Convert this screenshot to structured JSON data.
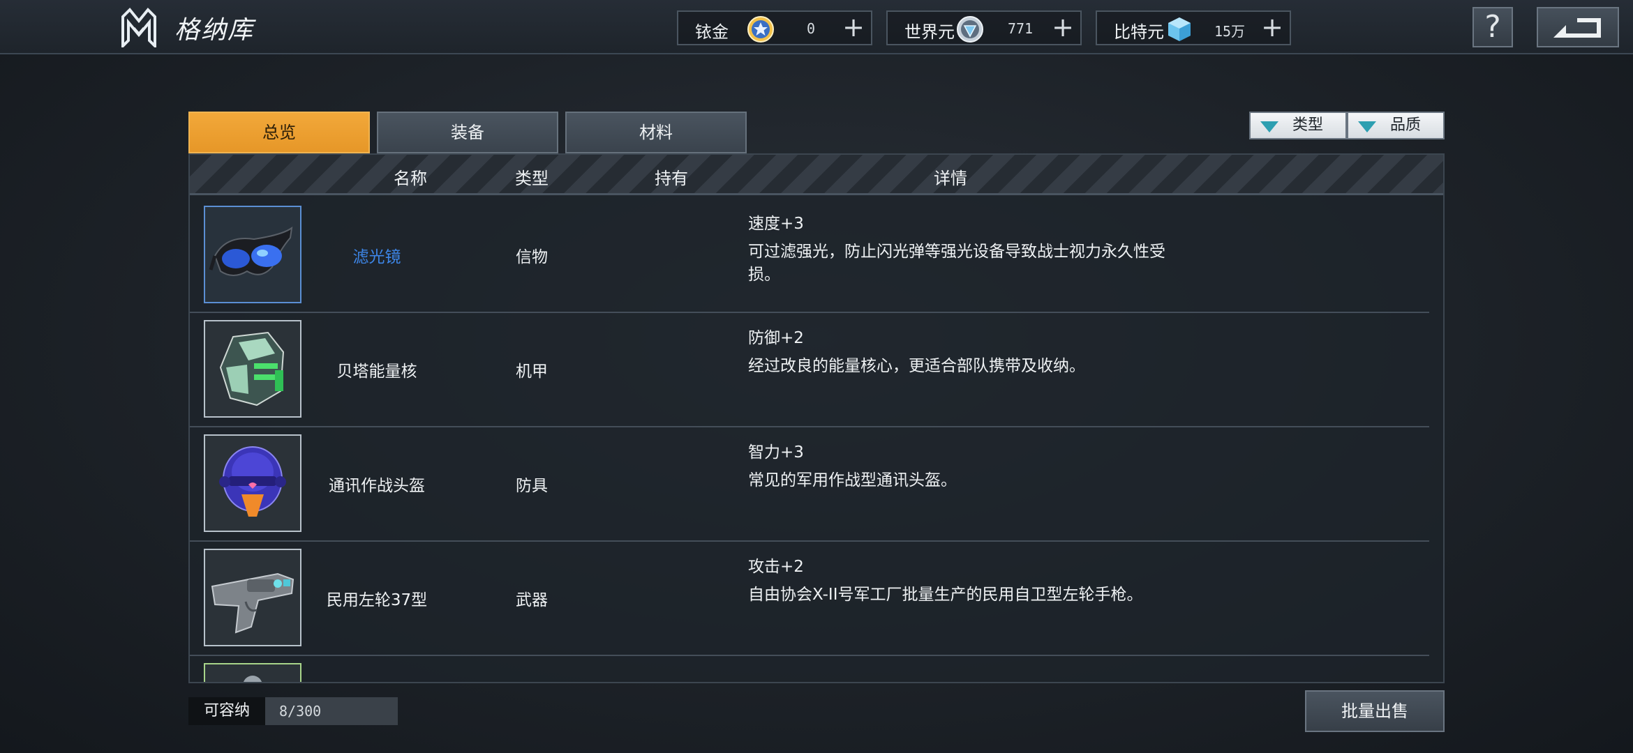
{
  "header": {
    "title": "格纳库"
  },
  "currencies": [
    {
      "name": "铱金",
      "value": "0",
      "icon": "star-coin-icon",
      "color": "#f2c14a"
    },
    {
      "name": "世界元",
      "value": "771",
      "icon": "silver-gem-coin-icon",
      "color": "#b8c4d0"
    },
    {
      "name": "比特元",
      "value": "15万",
      "icon": "blue-cube-icon",
      "color": "#5fb8e6"
    }
  ],
  "tabs": [
    {
      "label": "总览",
      "active": true
    },
    {
      "label": "装备",
      "active": false
    },
    {
      "label": "材料",
      "active": false
    }
  ],
  "filters": [
    {
      "label": "类型"
    },
    {
      "label": "品质"
    }
  ],
  "table": {
    "headers": {
      "name": "名称",
      "type": "类型",
      "owned": "持有",
      "detail": "详情"
    },
    "rows": [
      {
        "name": "滤光镜",
        "type": "信物",
        "stat": "速度+3",
        "desc": "可过滤强光，防止闪光弹等强光设备导致战士视力永久性受损。",
        "icon": "goggles-icon",
        "rarity_color": "#3d86e8"
      },
      {
        "name": "贝塔能量核",
        "type": "机甲",
        "stat": "防御+2",
        "desc": "经过改良的能量核心，更适合部队携带及收纳。",
        "icon": "energy-core-icon",
        "rarity_color": "#eef1f3"
      },
      {
        "name": "通讯作战头盔",
        "type": "防具",
        "stat": "智力+3",
        "desc": "常见的军用作战型通讯头盔。",
        "icon": "helmet-icon",
        "rarity_color": "#eef1f3"
      },
      {
        "name": "民用左轮37型",
        "type": "武器",
        "stat": "攻击+2",
        "desc": "自由协会X-II号军工厂批量生产的民用自卫型左轮手枪。",
        "icon": "revolver-icon",
        "rarity_color": "#eef1f3"
      }
    ]
  },
  "capacity": {
    "label": "可容纳",
    "value": "8/300"
  },
  "actions": {
    "bulk_sell": "批量出售"
  }
}
